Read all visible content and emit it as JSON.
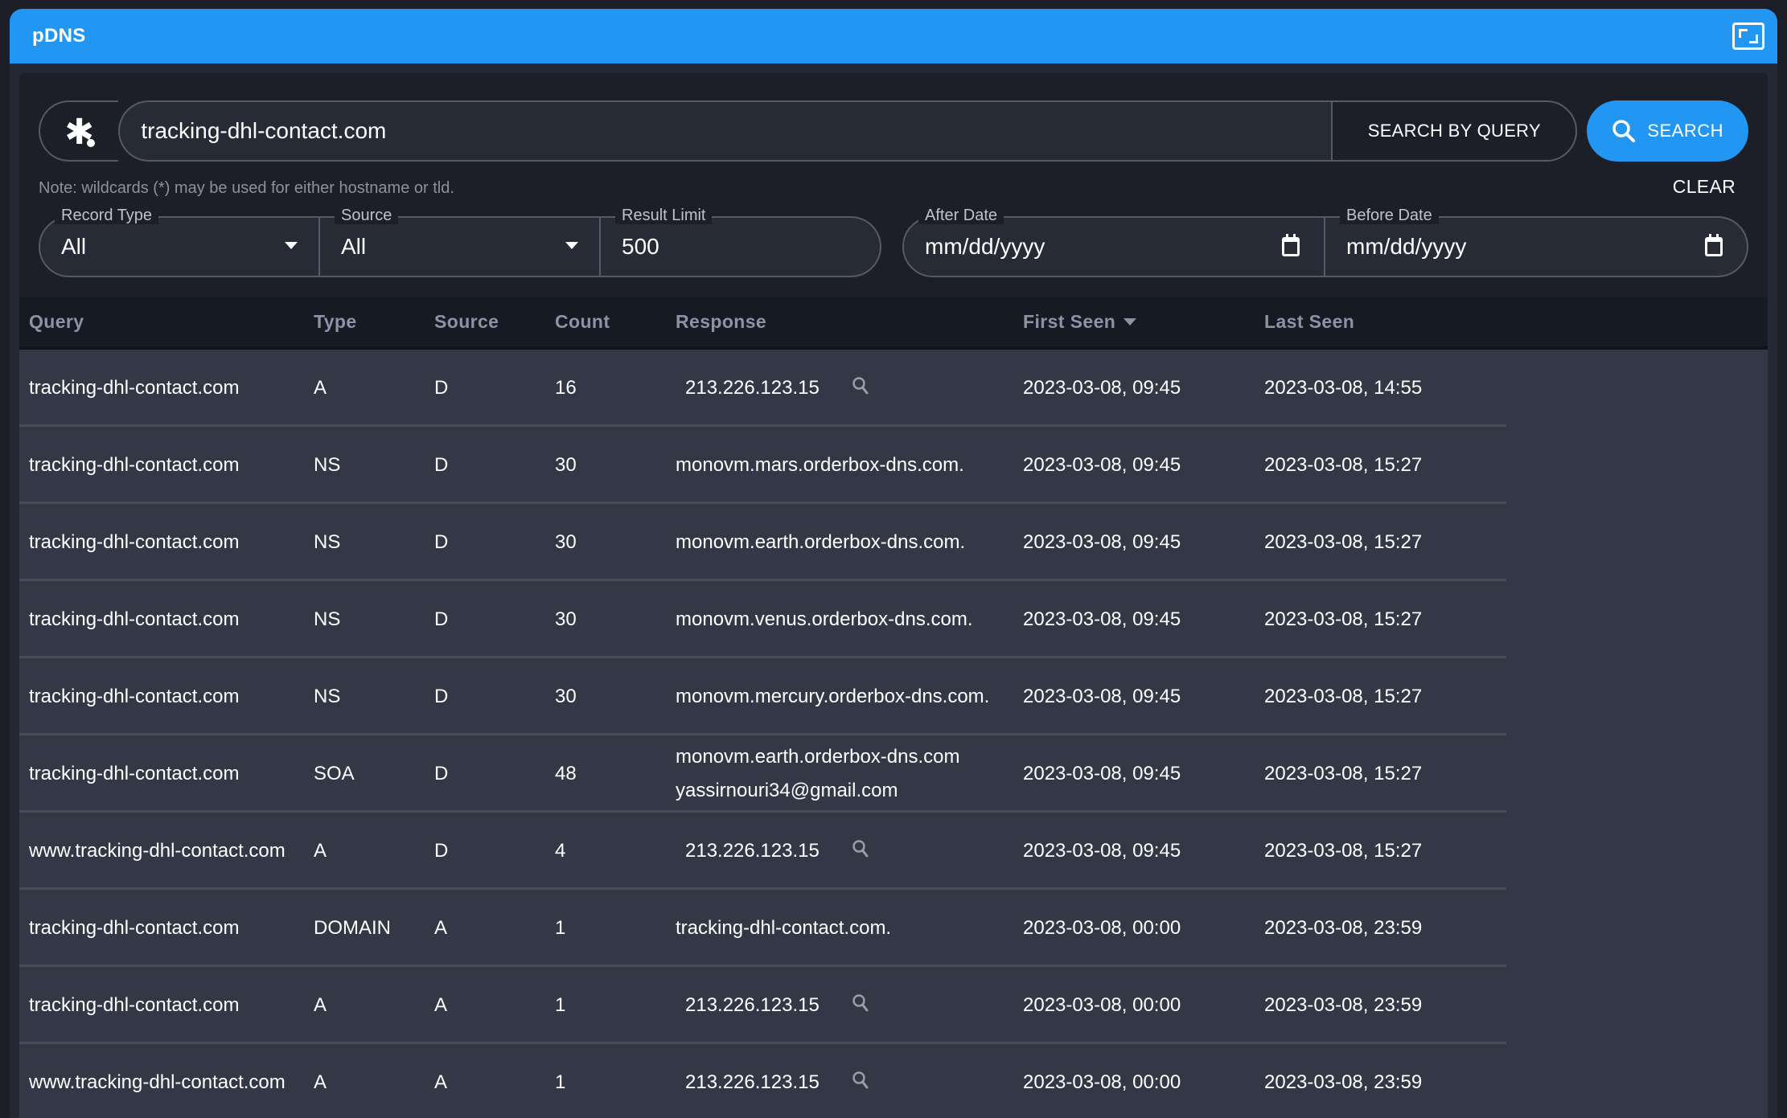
{
  "window": {
    "title": "pDNS",
    "expand_icon": "fullscreen-icon"
  },
  "search": {
    "wildcard_icon": "wildcard-asterisk-icon",
    "query_value": "tracking-dhl-contact.com",
    "search_by_query_label": "SEARCH BY QUERY",
    "search_button_label": "SEARCH",
    "note": "Note: wildcards (*) may be used for either hostname or tld.",
    "clear_label": "CLEAR"
  },
  "filters": {
    "record_type": {
      "label": "Record Type",
      "value": "All"
    },
    "source": {
      "label": "Source",
      "value": "All"
    },
    "result_limit": {
      "label": "Result Limit",
      "value": "500"
    },
    "after_date": {
      "label": "After Date",
      "placeholder": "mm/dd/yyyy"
    },
    "before_date": {
      "label": "Before Date",
      "placeholder": "mm/dd/yyyy"
    }
  },
  "table": {
    "headers": [
      "Query",
      "Type",
      "Source",
      "Count",
      "Response",
      "First Seen",
      "Last Seen"
    ],
    "sorted_column": "First Seen",
    "rows": [
      {
        "query": "tracking-dhl-contact.com",
        "type": "A",
        "source": "D",
        "count": "16",
        "response": [
          "213.226.123.15"
        ],
        "response_is_ip": true,
        "first_seen": "2023-03-08, 09:45",
        "last_seen": "2023-03-08, 14:55"
      },
      {
        "query": "tracking-dhl-contact.com",
        "type": "NS",
        "source": "D",
        "count": "30",
        "response": [
          "monovm.mars.orderbox-dns.com."
        ],
        "response_is_ip": false,
        "first_seen": "2023-03-08, 09:45",
        "last_seen": "2023-03-08, 15:27"
      },
      {
        "query": "tracking-dhl-contact.com",
        "type": "NS",
        "source": "D",
        "count": "30",
        "response": [
          "monovm.earth.orderbox-dns.com."
        ],
        "response_is_ip": false,
        "first_seen": "2023-03-08, 09:45",
        "last_seen": "2023-03-08, 15:27"
      },
      {
        "query": "tracking-dhl-contact.com",
        "type": "NS",
        "source": "D",
        "count": "30",
        "response": [
          "monovm.venus.orderbox-dns.com."
        ],
        "response_is_ip": false,
        "first_seen": "2023-03-08, 09:45",
        "last_seen": "2023-03-08, 15:27"
      },
      {
        "query": "tracking-dhl-contact.com",
        "type": "NS",
        "source": "D",
        "count": "30",
        "response": [
          "monovm.mercury.orderbox-dns.com."
        ],
        "response_is_ip": false,
        "first_seen": "2023-03-08, 09:45",
        "last_seen": "2023-03-08, 15:27"
      },
      {
        "query": "tracking-dhl-contact.com",
        "type": "SOA",
        "source": "D",
        "count": "48",
        "response": [
          "monovm.earth.orderbox-dns.com",
          "yassirnouri34@gmail.com"
        ],
        "response_is_ip": false,
        "first_seen": "2023-03-08, 09:45",
        "last_seen": "2023-03-08, 15:27"
      },
      {
        "query": "www.tracking-dhl-contact.com",
        "type": "A",
        "source": "D",
        "count": "4",
        "response": [
          "213.226.123.15"
        ],
        "response_is_ip": true,
        "first_seen": "2023-03-08, 09:45",
        "last_seen": "2023-03-08, 15:27"
      },
      {
        "query": "tracking-dhl-contact.com",
        "type": "DOMAIN",
        "source": "A",
        "count": "1",
        "response": [
          "tracking-dhl-contact.com."
        ],
        "response_is_ip": false,
        "first_seen": "2023-03-08, 00:00",
        "last_seen": "2023-03-08, 23:59"
      },
      {
        "query": "tracking-dhl-contact.com",
        "type": "A",
        "source": "A",
        "count": "1",
        "response": [
          "213.226.123.15"
        ],
        "response_is_ip": true,
        "first_seen": "2023-03-08, 00:00",
        "last_seen": "2023-03-08, 23:59"
      },
      {
        "query": "www.tracking-dhl-contact.com",
        "type": "A",
        "source": "A",
        "count": "1",
        "response": [
          "213.226.123.15"
        ],
        "response_is_ip": true,
        "first_seen": "2023-03-08, 00:00",
        "last_seen": "2023-03-08, 23:59"
      }
    ]
  },
  "colors": {
    "accent": "#2196f3",
    "background": "#1c1f28",
    "row_bg": "#333846",
    "header_bg": "#161a23",
    "header_text": "#8b93a7"
  }
}
